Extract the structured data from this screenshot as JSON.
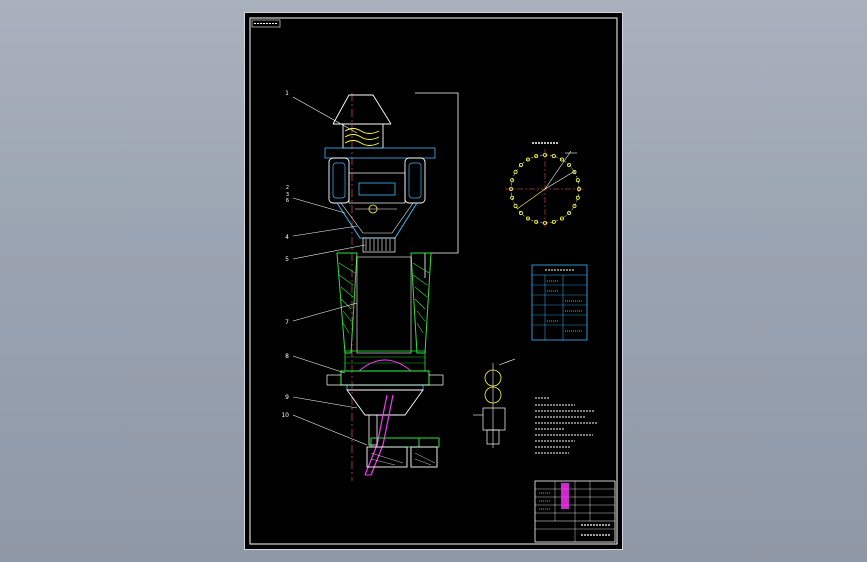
{
  "viewer": {
    "background_color": "#9aa3b1",
    "sheet_color": "#000000"
  },
  "drawing": {
    "part_numbers": [
      "1",
      "2",
      "3",
      "4",
      "5",
      "6",
      "7",
      "8",
      "9",
      "10"
    ],
    "colors": {
      "outline": "#ffffff",
      "section": "#27e63a",
      "centerline": "#ff5b5b",
      "highlight": "#ffff33",
      "accent": "#ff33ff",
      "detail": "#39b8ff"
    }
  }
}
